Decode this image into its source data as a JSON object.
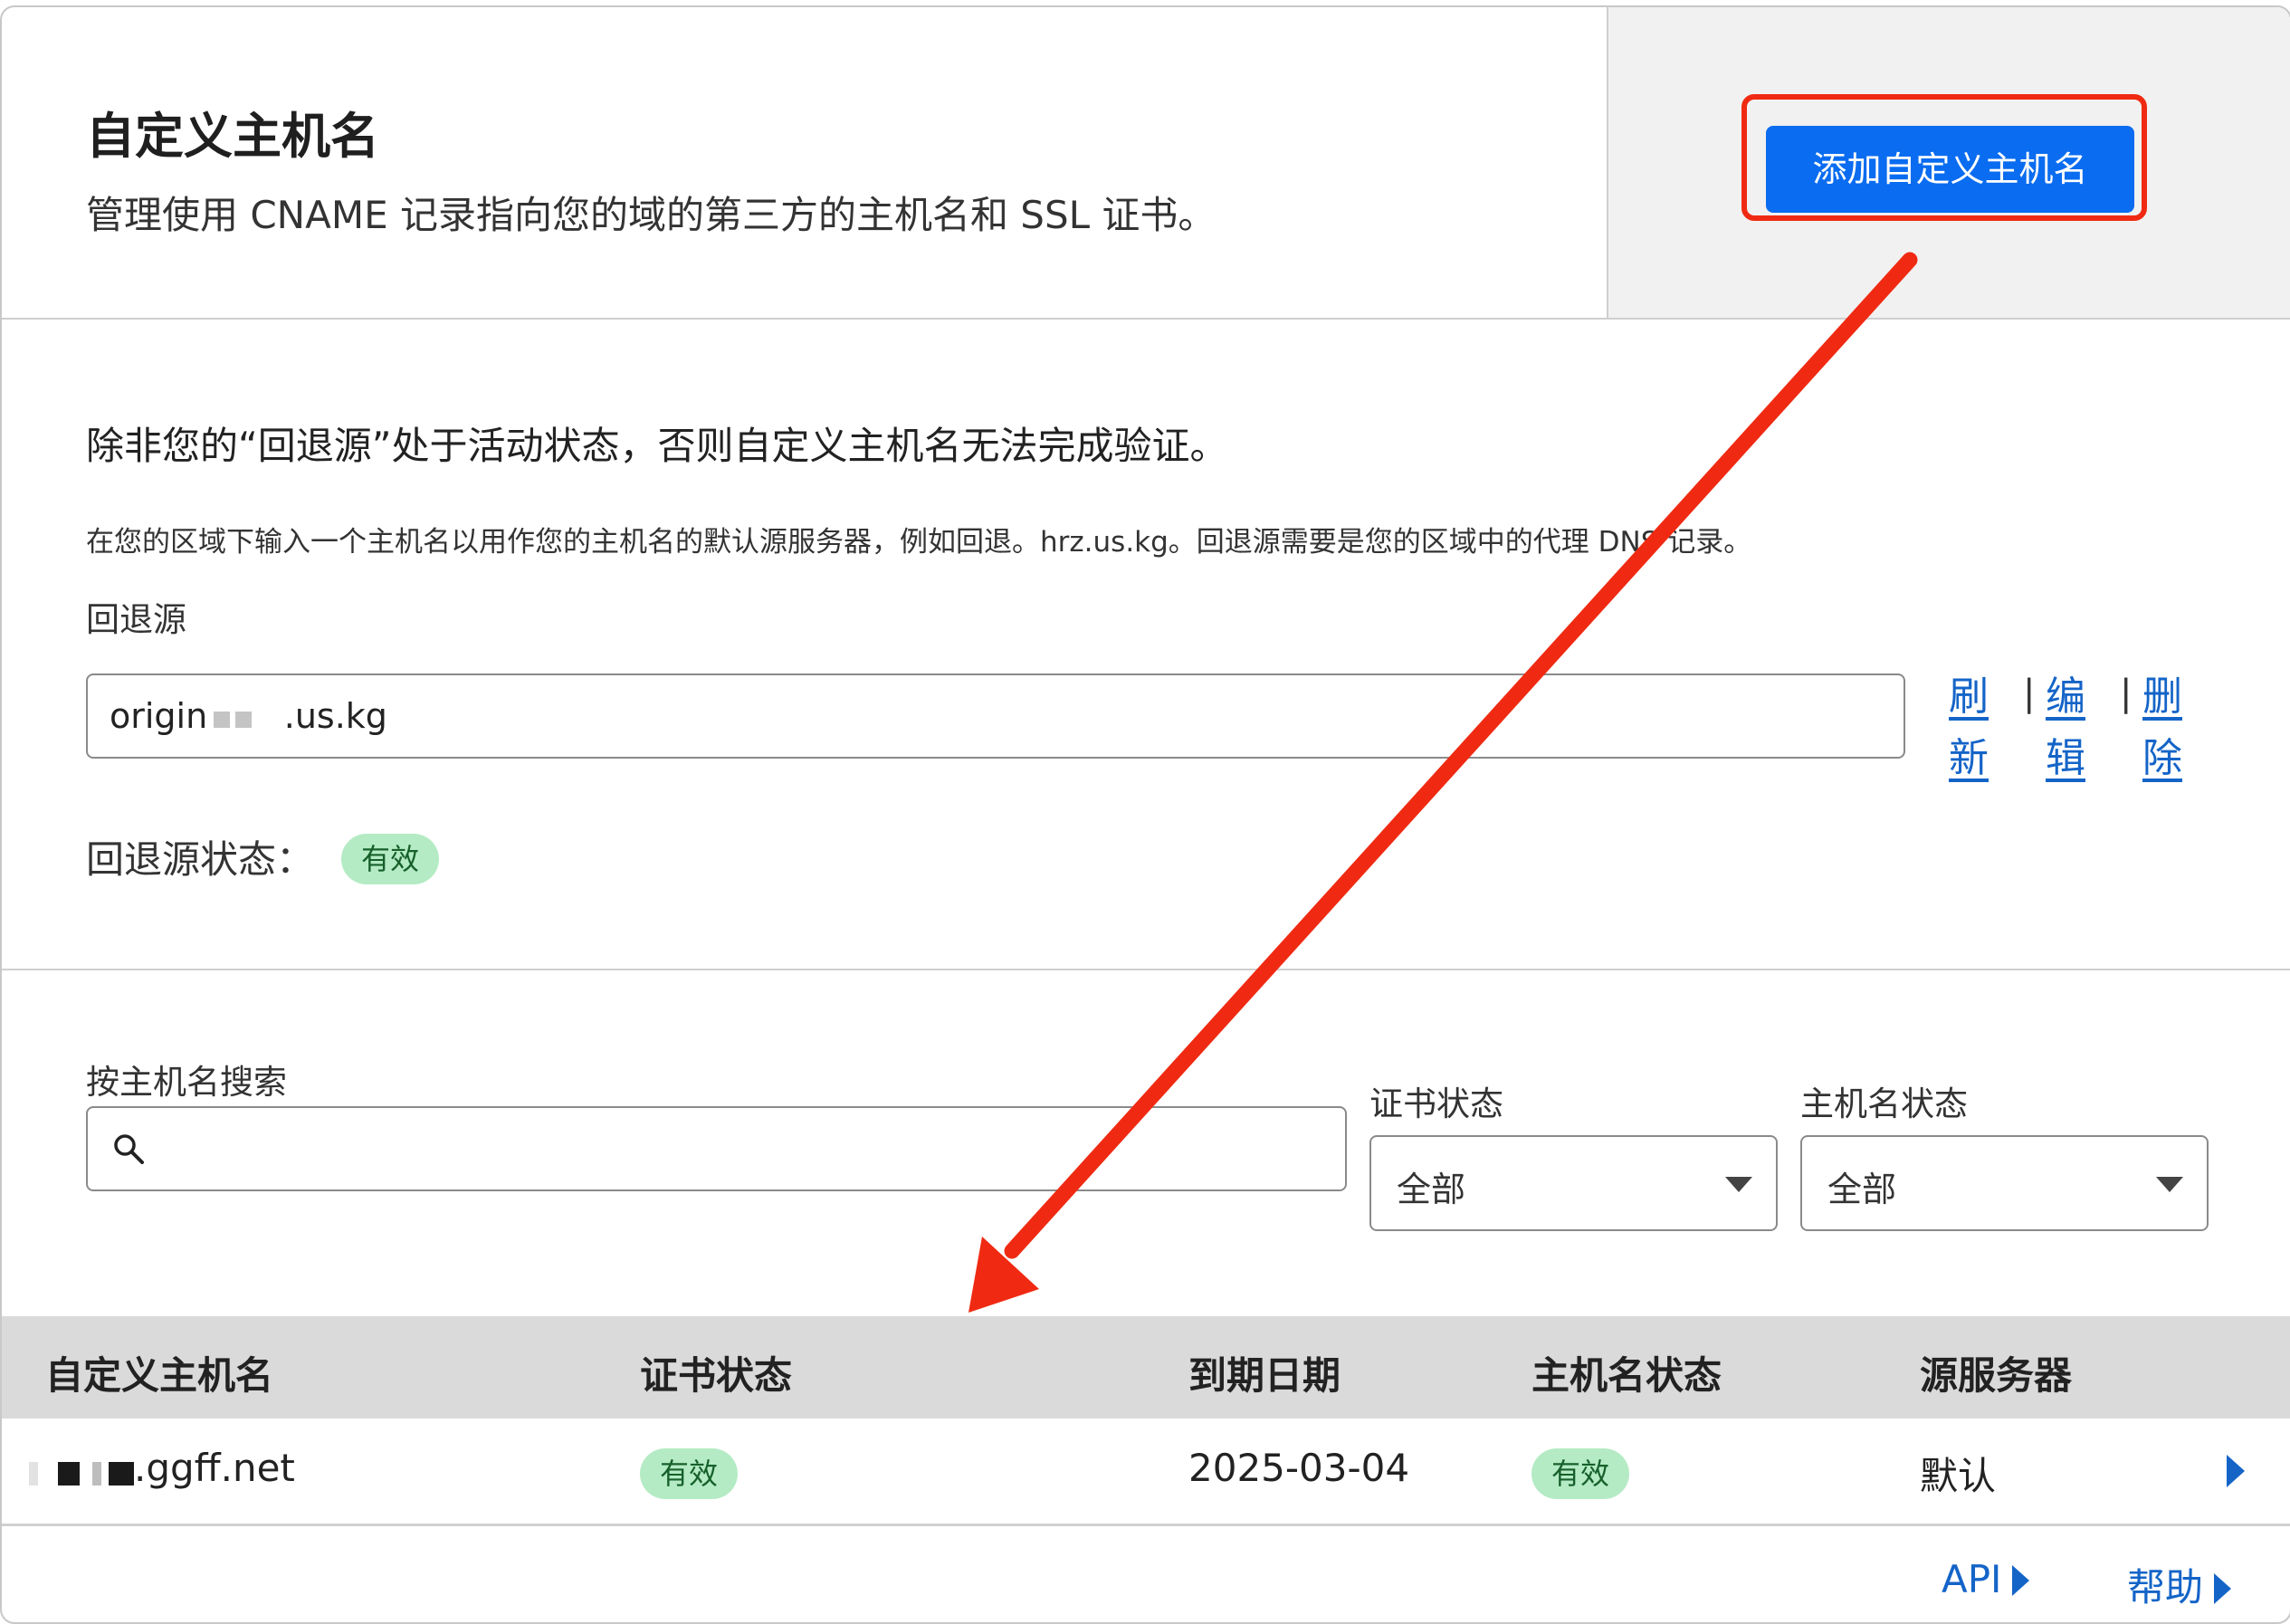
{
  "header": {
    "title": "自定义主机名",
    "subtitle": "管理使用 CNAME 记录指向您的域的第三方的主机名和 SSL 证书。",
    "add_button": "添加自定义主机名"
  },
  "fallback": {
    "warning": "除非您的“回退源”处于活动状态，否则自定义主机名无法完成验证。",
    "help_text": "在您的区域下输入一个主机名以用作您的主机名的默认源服务器，例如回退。hrz.us.kg。回退源需要是您的区域中的代理 DNS 记录。",
    "label": "回退源",
    "value": "origin.      .us.kg",
    "actions": [
      {
        "top": "刷",
        "bottom": "新"
      },
      {
        "top": "编",
        "bottom": "辑"
      },
      {
        "top": "删",
        "bottom": "除"
      }
    ],
    "separator": "|",
    "status_label": "回退源状态：",
    "status_badge": "有效"
  },
  "filters": {
    "search_label": "按主机名搜索",
    "search_value": "",
    "cert_status_label": "证书状态",
    "cert_status_value": "全部",
    "host_status_label": "主机名状态",
    "host_status_value": "全部"
  },
  "table": {
    "headers": [
      "自定义主机名",
      "证书状态",
      "到期日期",
      "主机名状态",
      "源服务器"
    ],
    "rows": [
      {
        "hostname": ".ggff.net",
        "cert_status": "有效",
        "expiry": "2025-03-04",
        "host_status": "有效",
        "origin": "默认"
      }
    ]
  },
  "footer": {
    "api_link": "API",
    "help_link": "帮助"
  },
  "colors": {
    "primary": "#0a6cf0",
    "link": "#1464c8",
    "badge_bg": "#b4ebc4",
    "annotation": "#f02a12"
  }
}
